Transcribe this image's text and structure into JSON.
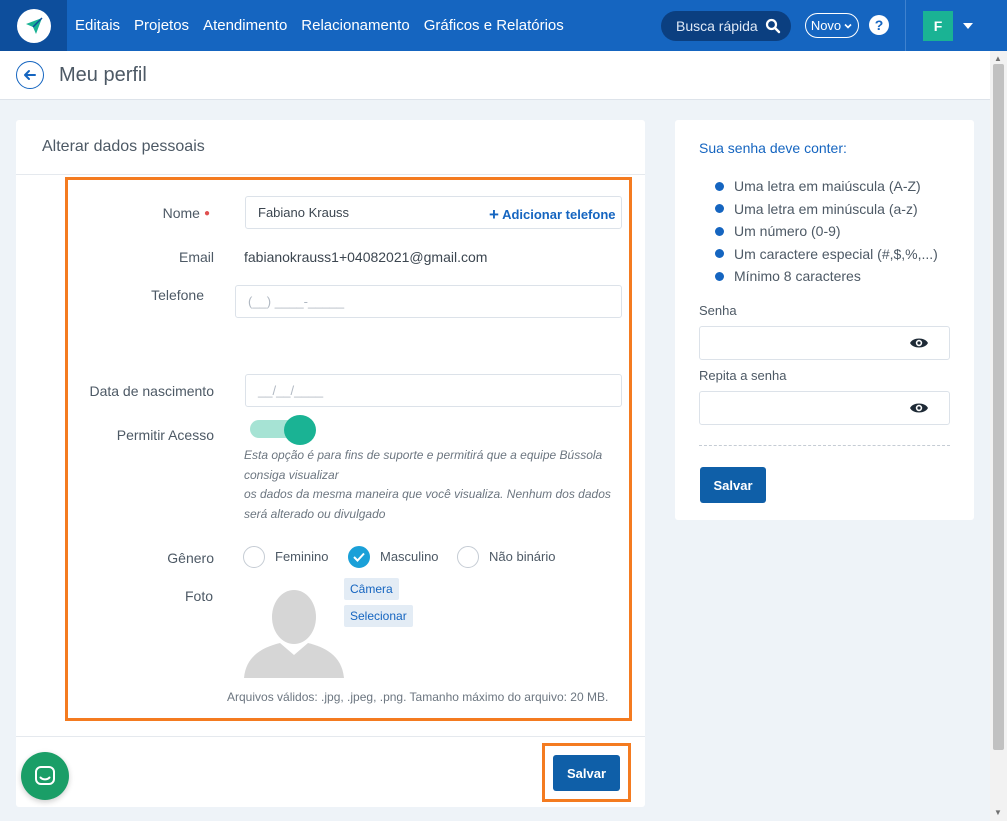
{
  "nav": {
    "items": [
      "Editais",
      "Projetos",
      "Atendimento",
      "Relacionamento",
      "Gráficos e Relatórios"
    ],
    "search_label": "Busca rápida",
    "novo_label": "Novo",
    "help_label": "?",
    "avatar_letter": "F"
  },
  "page": {
    "title": "Meu perfil"
  },
  "form": {
    "title": "Alterar dados pessoais",
    "nome_label": "Nome",
    "nome_value": "Fabiano Krauss",
    "email_label": "Email",
    "email_value": "fabianokrauss1+04082021@gmail.com",
    "telefone_label": "Telefone",
    "telefone_placeholder": "(__) ____-_____",
    "add_phone_label": "Adicionar telefone",
    "nascimento_label": "Data de nascimento",
    "nascimento_placeholder": "__/__/____",
    "acesso_label": "Permitir Acesso",
    "acesso_on": true,
    "acesso_note_1": "Esta opção é para fins de suporte e permitirá que a equipe Bússola consiga visualizar",
    "acesso_note_2": "os dados da mesma maneira que você visualiza. Nenhum dos dados será alterado ou divulgado",
    "genero_label": "Gênero",
    "genero_options": [
      "Feminino",
      "Masculino",
      "Não binário"
    ],
    "genero_selected": "Masculino",
    "foto_label": "Foto",
    "camera_label": "Câmera",
    "selecionar_label": "Selecionar",
    "files_note": "Arquivos válidos: .jpg, .jpeg, .png. Tamanho máximo do arquivo: 20 MB.",
    "save_label": "Salvar"
  },
  "password": {
    "title": "Sua senha deve conter:",
    "rules": [
      "Uma letra em maiúscula (A-Z)",
      "Uma letra em minúscula (a-z)",
      "Um número (0-9)",
      "Um caractere especial (#,$,%,...)",
      "Mínimo 8 caracteres"
    ],
    "senha_label": "Senha",
    "repita_label": "Repita a senha",
    "save_label": "Salvar"
  },
  "colors": {
    "brand": "#1565c0",
    "accent": "#1ab394",
    "highlight": "#f47b20"
  }
}
